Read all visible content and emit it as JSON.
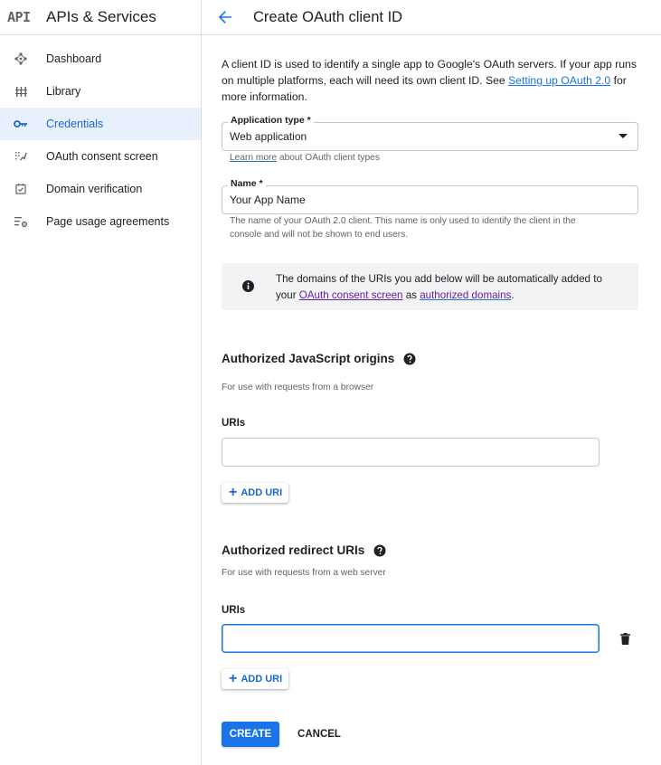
{
  "app": {
    "logo_text": "API",
    "title": "APIs & Services"
  },
  "sidebar": {
    "items": [
      {
        "label": "Dashboard",
        "icon": "dashboard-icon"
      },
      {
        "label": "Library",
        "icon": "library-icon"
      },
      {
        "label": "Credentials",
        "icon": "key-icon",
        "active": true
      },
      {
        "label": "OAuth consent screen",
        "icon": "consent-icon"
      },
      {
        "label": "Domain verification",
        "icon": "domain-check-icon"
      },
      {
        "label": "Page usage agreements",
        "icon": "settings-list-icon"
      }
    ]
  },
  "header": {
    "title": "Create OAuth client ID"
  },
  "intro": {
    "text_before": "A client ID is used to identify a single app to Google's OAuth servers. If your app runs on multiple platforms, each will need its own client ID. See ",
    "link": "Setting up OAuth 2.0",
    "text_after": " for more information."
  },
  "app_type": {
    "label": "Application type *",
    "value": "Web application",
    "hint_link": "Learn more",
    "hint_text": " about OAuth client types"
  },
  "name_field": {
    "label": "Name *",
    "value": "Your App Name",
    "hint": "The name of your OAuth 2.0 client. This name is only used to identify the client in the console and will not be shown to end users."
  },
  "info": {
    "text_before": "The domains of the URIs you add below will be automatically added to your ",
    "link1": "OAuth consent screen",
    "text_mid": " as ",
    "link2": "authorized domains",
    "text_after": "."
  },
  "js_origins": {
    "title": "Authorized JavaScript origins",
    "subtitle": "For use with requests from a browser",
    "uris_label": "URIs",
    "add_label": "ADD URI"
  },
  "redirect_uris": {
    "title": "Authorized redirect URIs",
    "subtitle": "For use with requests from a web server",
    "uris_label": "URIs",
    "add_label": "ADD URI"
  },
  "actions": {
    "create": "CREATE",
    "cancel": "CANCEL"
  },
  "colors": {
    "accent": "#1a73e8",
    "active_bg": "#e8f0fe",
    "visited_link": "#681da8"
  }
}
